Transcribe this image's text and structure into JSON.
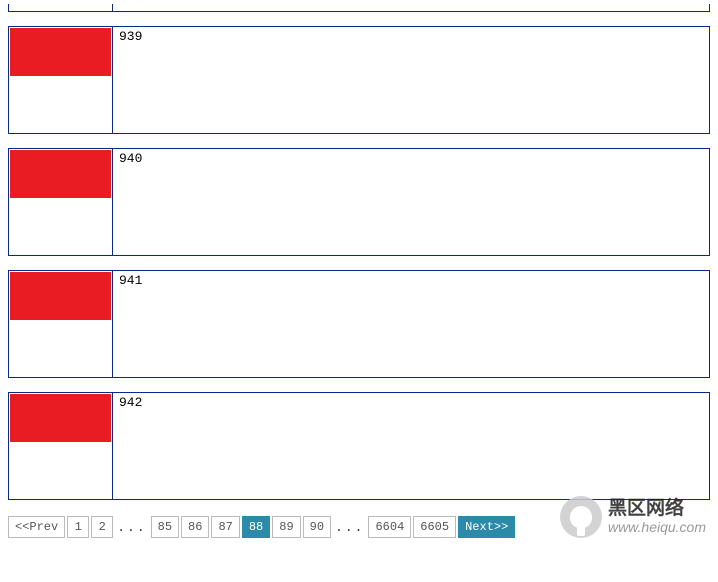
{
  "items": [
    {
      "id": "939"
    },
    {
      "id": "940"
    },
    {
      "id": "941"
    },
    {
      "id": "942"
    }
  ],
  "pagination": {
    "prev": "<<Prev",
    "next": "Next>>",
    "ellipsis": "...",
    "pages_left": [
      "1",
      "2"
    ],
    "pages_mid": [
      "85",
      "86",
      "87",
      "88",
      "89",
      "90"
    ],
    "pages_right": [
      "6604",
      "6605"
    ],
    "current": "88"
  },
  "watermark": {
    "cn": "黑区网络",
    "url": "www.heiqu.com"
  }
}
